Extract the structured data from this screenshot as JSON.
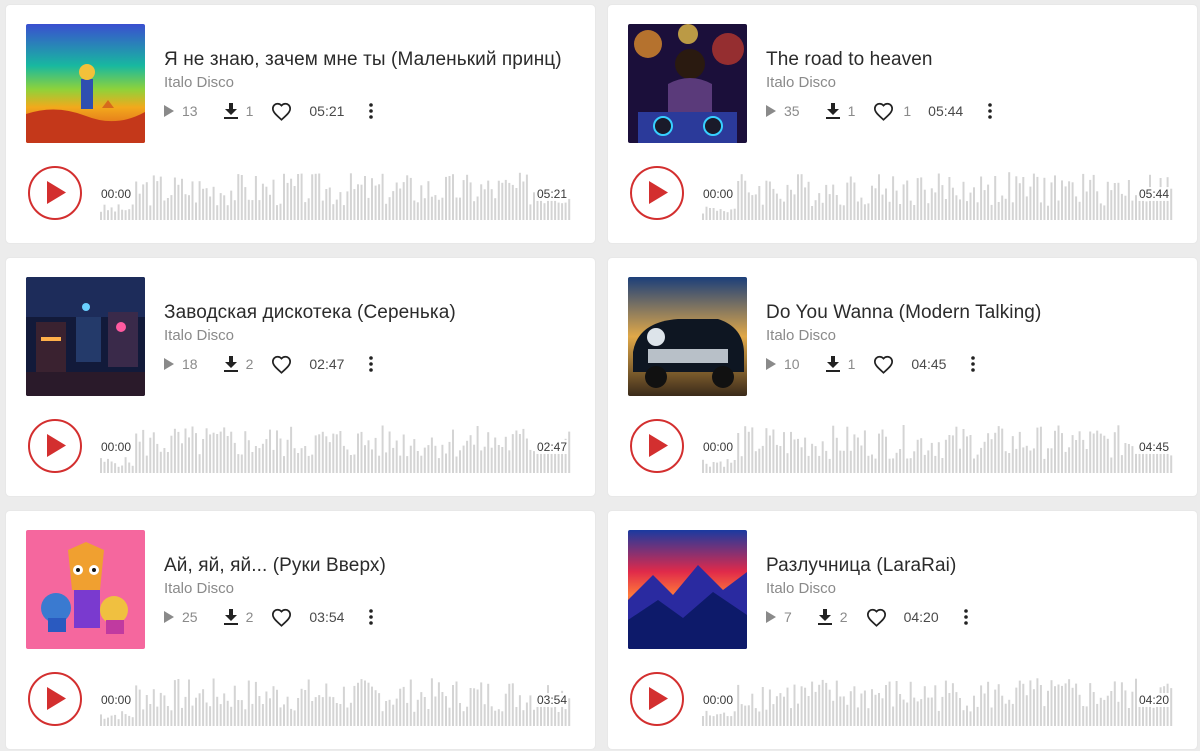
{
  "tracks": [
    {
      "title": "Я не знаю, зачем мне ты (Маленький принц)",
      "genre": "Italo Disco",
      "plays": "13",
      "downloads": "1",
      "likes": "",
      "duration": "05:21",
      "current_time": "00:00",
      "total_time": "05:21",
      "cover": "little-prince-cover"
    },
    {
      "title": "The road to heaven",
      "genre": "Italo Disco",
      "plays": "35",
      "downloads": "1",
      "likes": "1",
      "duration": "05:44",
      "current_time": "00:00",
      "total_time": "05:44",
      "cover": "dj-party-cover"
    },
    {
      "title": "Заводская дискотека (Серенька)",
      "genre": "Italo Disco",
      "plays": "18",
      "downloads": "2",
      "likes": "",
      "duration": "02:47",
      "current_time": "00:00",
      "total_time": "02:47",
      "cover": "factory-disco-cover"
    },
    {
      "title": "Do You Wanna (Modern Talking)",
      "genre": "Italo Disco",
      "plays": "10",
      "downloads": "1",
      "likes": "",
      "duration": "04:45",
      "current_time": "00:00",
      "total_time": "04:45",
      "cover": "retro-car-cover"
    },
    {
      "title": "Ай, яй, яй... (Руки Вверх)",
      "genre": "Italo Disco",
      "plays": "25",
      "downloads": "2",
      "likes": "",
      "duration": "03:54",
      "current_time": "00:00",
      "total_time": "03:54",
      "cover": "cartoon-hands-cover"
    },
    {
      "title": "Разлучница (LaraRai)",
      "genre": "Italo Disco",
      "plays": "7",
      "downloads": "2",
      "likes": "",
      "duration": "04:20",
      "current_time": "00:00",
      "total_time": "04:20",
      "cover": "mountains-cover"
    }
  ],
  "colors": {
    "accent": "#d32f2f",
    "waveform": "#d4d4d4",
    "card_bg": "#ffffff",
    "page_bg": "#ececec"
  },
  "icons": {
    "play": "play-icon",
    "plays": "plays-triangle-icon",
    "download": "download-icon",
    "like": "heart-icon",
    "more": "more-vertical-icon"
  }
}
